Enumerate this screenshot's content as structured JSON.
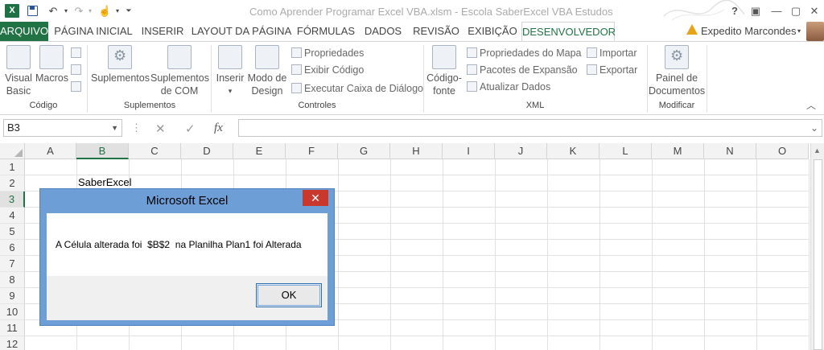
{
  "window": {
    "title": "Como Aprender Programar Excel VBA.xlsm - Escola SaberExcel VBA Estudos",
    "app_icon": "X",
    "help_label": "?",
    "controls": [
      "restore-icon",
      "minimize-icon",
      "maximize-icon",
      "close-icon"
    ]
  },
  "ribbon_tabs": {
    "file": "ARQUIVO",
    "items": [
      "PÁGINA INICIAL",
      "INSERIR",
      "LAYOUT DA PÁGINA",
      "FÓRMULAS",
      "DADOS",
      "REVISÃO",
      "EXIBIÇÃO",
      "DESENVOLVEDOR"
    ],
    "active": "DESENVOLVEDOR",
    "user": "Expedito Marcondes"
  },
  "ribbon": {
    "codigo": {
      "label": "Código",
      "visual_basic_1": "Visual",
      "visual_basic_2": "Basic",
      "macros": "Macros"
    },
    "suplementos": {
      "label": "Suplementos",
      "suplementos": "Suplementos",
      "com_1": "Suplementos",
      "com_2": "de COM"
    },
    "controles": {
      "label": "Controles",
      "inserir": "Inserir",
      "modo_1": "Modo de",
      "modo_2": "Design",
      "propriedades": "Propriedades",
      "exibir_codigo": "Exibir Código",
      "executar": "Executar Caixa de Diálogo"
    },
    "xml": {
      "label": "XML",
      "fonte_1": "Código-",
      "fonte_2": "fonte",
      "prop_mapa": "Propriedades do Mapa",
      "pacotes": "Pacotes de Expansão",
      "atualizar": "Atualizar Dados",
      "importar": "Importar",
      "exportar": "Exportar"
    },
    "modificar": {
      "label": "Modificar",
      "painel_1": "Painel de",
      "painel_2": "Documentos"
    }
  },
  "formula_bar": {
    "name_box": "B3",
    "fx_label": "fx",
    "value": ""
  },
  "grid": {
    "columns": [
      "A",
      "B",
      "C",
      "D",
      "E",
      "F",
      "G",
      "H",
      "I",
      "J",
      "K",
      "L",
      "M",
      "N",
      "O"
    ],
    "selected_column": "B",
    "rows": [
      "1",
      "2",
      "3",
      "4",
      "5",
      "6",
      "7",
      "8",
      "9",
      "10",
      "11",
      "12"
    ],
    "selected_row": "3",
    "cell_B2": "SaberExcel"
  },
  "dialog": {
    "title": "Microsoft Excel",
    "message": "A Célula alterada foi  $B$2  na Planilha Plan1 foi Alterada",
    "ok_label": "OK"
  }
}
